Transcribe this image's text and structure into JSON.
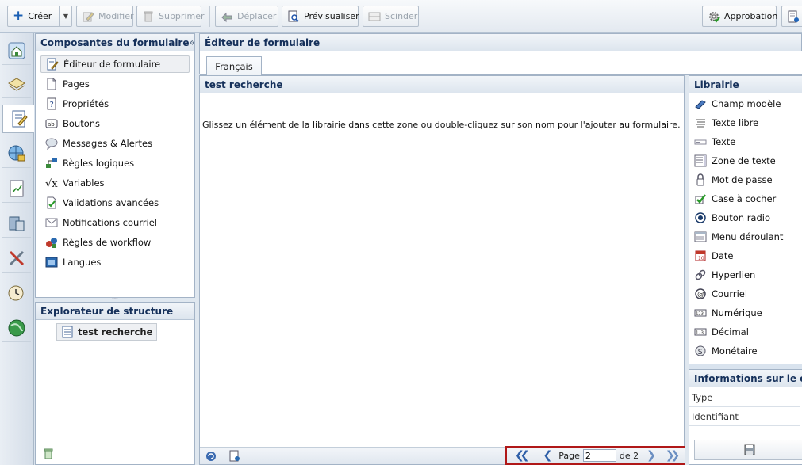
{
  "toolbar": {
    "creer": "Créer",
    "modifier": "Modifier",
    "supprimer": "Supprimer",
    "deplacer": "Déplacer",
    "previsualiser": "Prévisualiser",
    "scinder": "Scinder",
    "approbation": "Approbation"
  },
  "components": {
    "title": "Composantes du formulaire",
    "collapse": "«",
    "items": [
      {
        "label": "Éditeur de formulaire",
        "icon": "form-editor-icon"
      },
      {
        "label": "Pages",
        "icon": "pages-icon"
      },
      {
        "label": "Propriétés",
        "icon": "properties-icon"
      },
      {
        "label": "Boutons",
        "icon": "buttons-icon"
      },
      {
        "label": "Messages & Alertes",
        "icon": "messages-icon"
      },
      {
        "label": "Règles logiques",
        "icon": "logic-rules-icon"
      },
      {
        "label": "Variables",
        "icon": "variables-icon"
      },
      {
        "label": "Validations avancées",
        "icon": "validations-icon"
      },
      {
        "label": "Notifications courriel",
        "icon": "email-notifications-icon"
      },
      {
        "label": "Règles de workflow",
        "icon": "workflow-rules-icon"
      },
      {
        "label": "Langues",
        "icon": "languages-icon"
      }
    ]
  },
  "explorer": {
    "title": "Explorateur de structure",
    "node": "test recherche"
  },
  "editor": {
    "title": "Éditeur de formulaire",
    "tab": "Français",
    "form_title": "test recherche",
    "drop_hint": "Glissez un élément de la librairie dans cette zone ou double-cliquez sur son nom pour l'ajouter au formulaire."
  },
  "pager": {
    "page_label": "Page",
    "page_value": "2",
    "of_label": "de 2"
  },
  "library": {
    "title": "Librairie",
    "items": [
      {
        "label": "Champ modèle",
        "icon": "template-field-icon"
      },
      {
        "label": "Texte libre",
        "icon": "free-text-icon"
      },
      {
        "label": "Texte",
        "icon": "text-field-icon"
      },
      {
        "label": "Zone de texte",
        "icon": "textarea-icon"
      },
      {
        "label": "Mot de passe",
        "icon": "password-icon"
      },
      {
        "label": "Case à cocher",
        "icon": "checkbox-icon"
      },
      {
        "label": "Bouton radio",
        "icon": "radio-icon"
      },
      {
        "label": "Menu déroulant",
        "icon": "dropdown-icon"
      },
      {
        "label": "Date",
        "icon": "date-icon"
      },
      {
        "label": "Hyperlien",
        "icon": "hyperlink-icon"
      },
      {
        "label": "Courriel",
        "icon": "email-icon"
      },
      {
        "label": "Numérique",
        "icon": "numeric-icon"
      },
      {
        "label": "Décimal",
        "icon": "decimal-icon"
      },
      {
        "label": "Monétaire",
        "icon": "currency-icon"
      }
    ]
  },
  "info": {
    "title": "Informations sur le ch",
    "rows": [
      "Type",
      "Identifiant"
    ]
  },
  "colors": {
    "panel_header_text": "#15305a",
    "highlight_border": "#b01818"
  }
}
